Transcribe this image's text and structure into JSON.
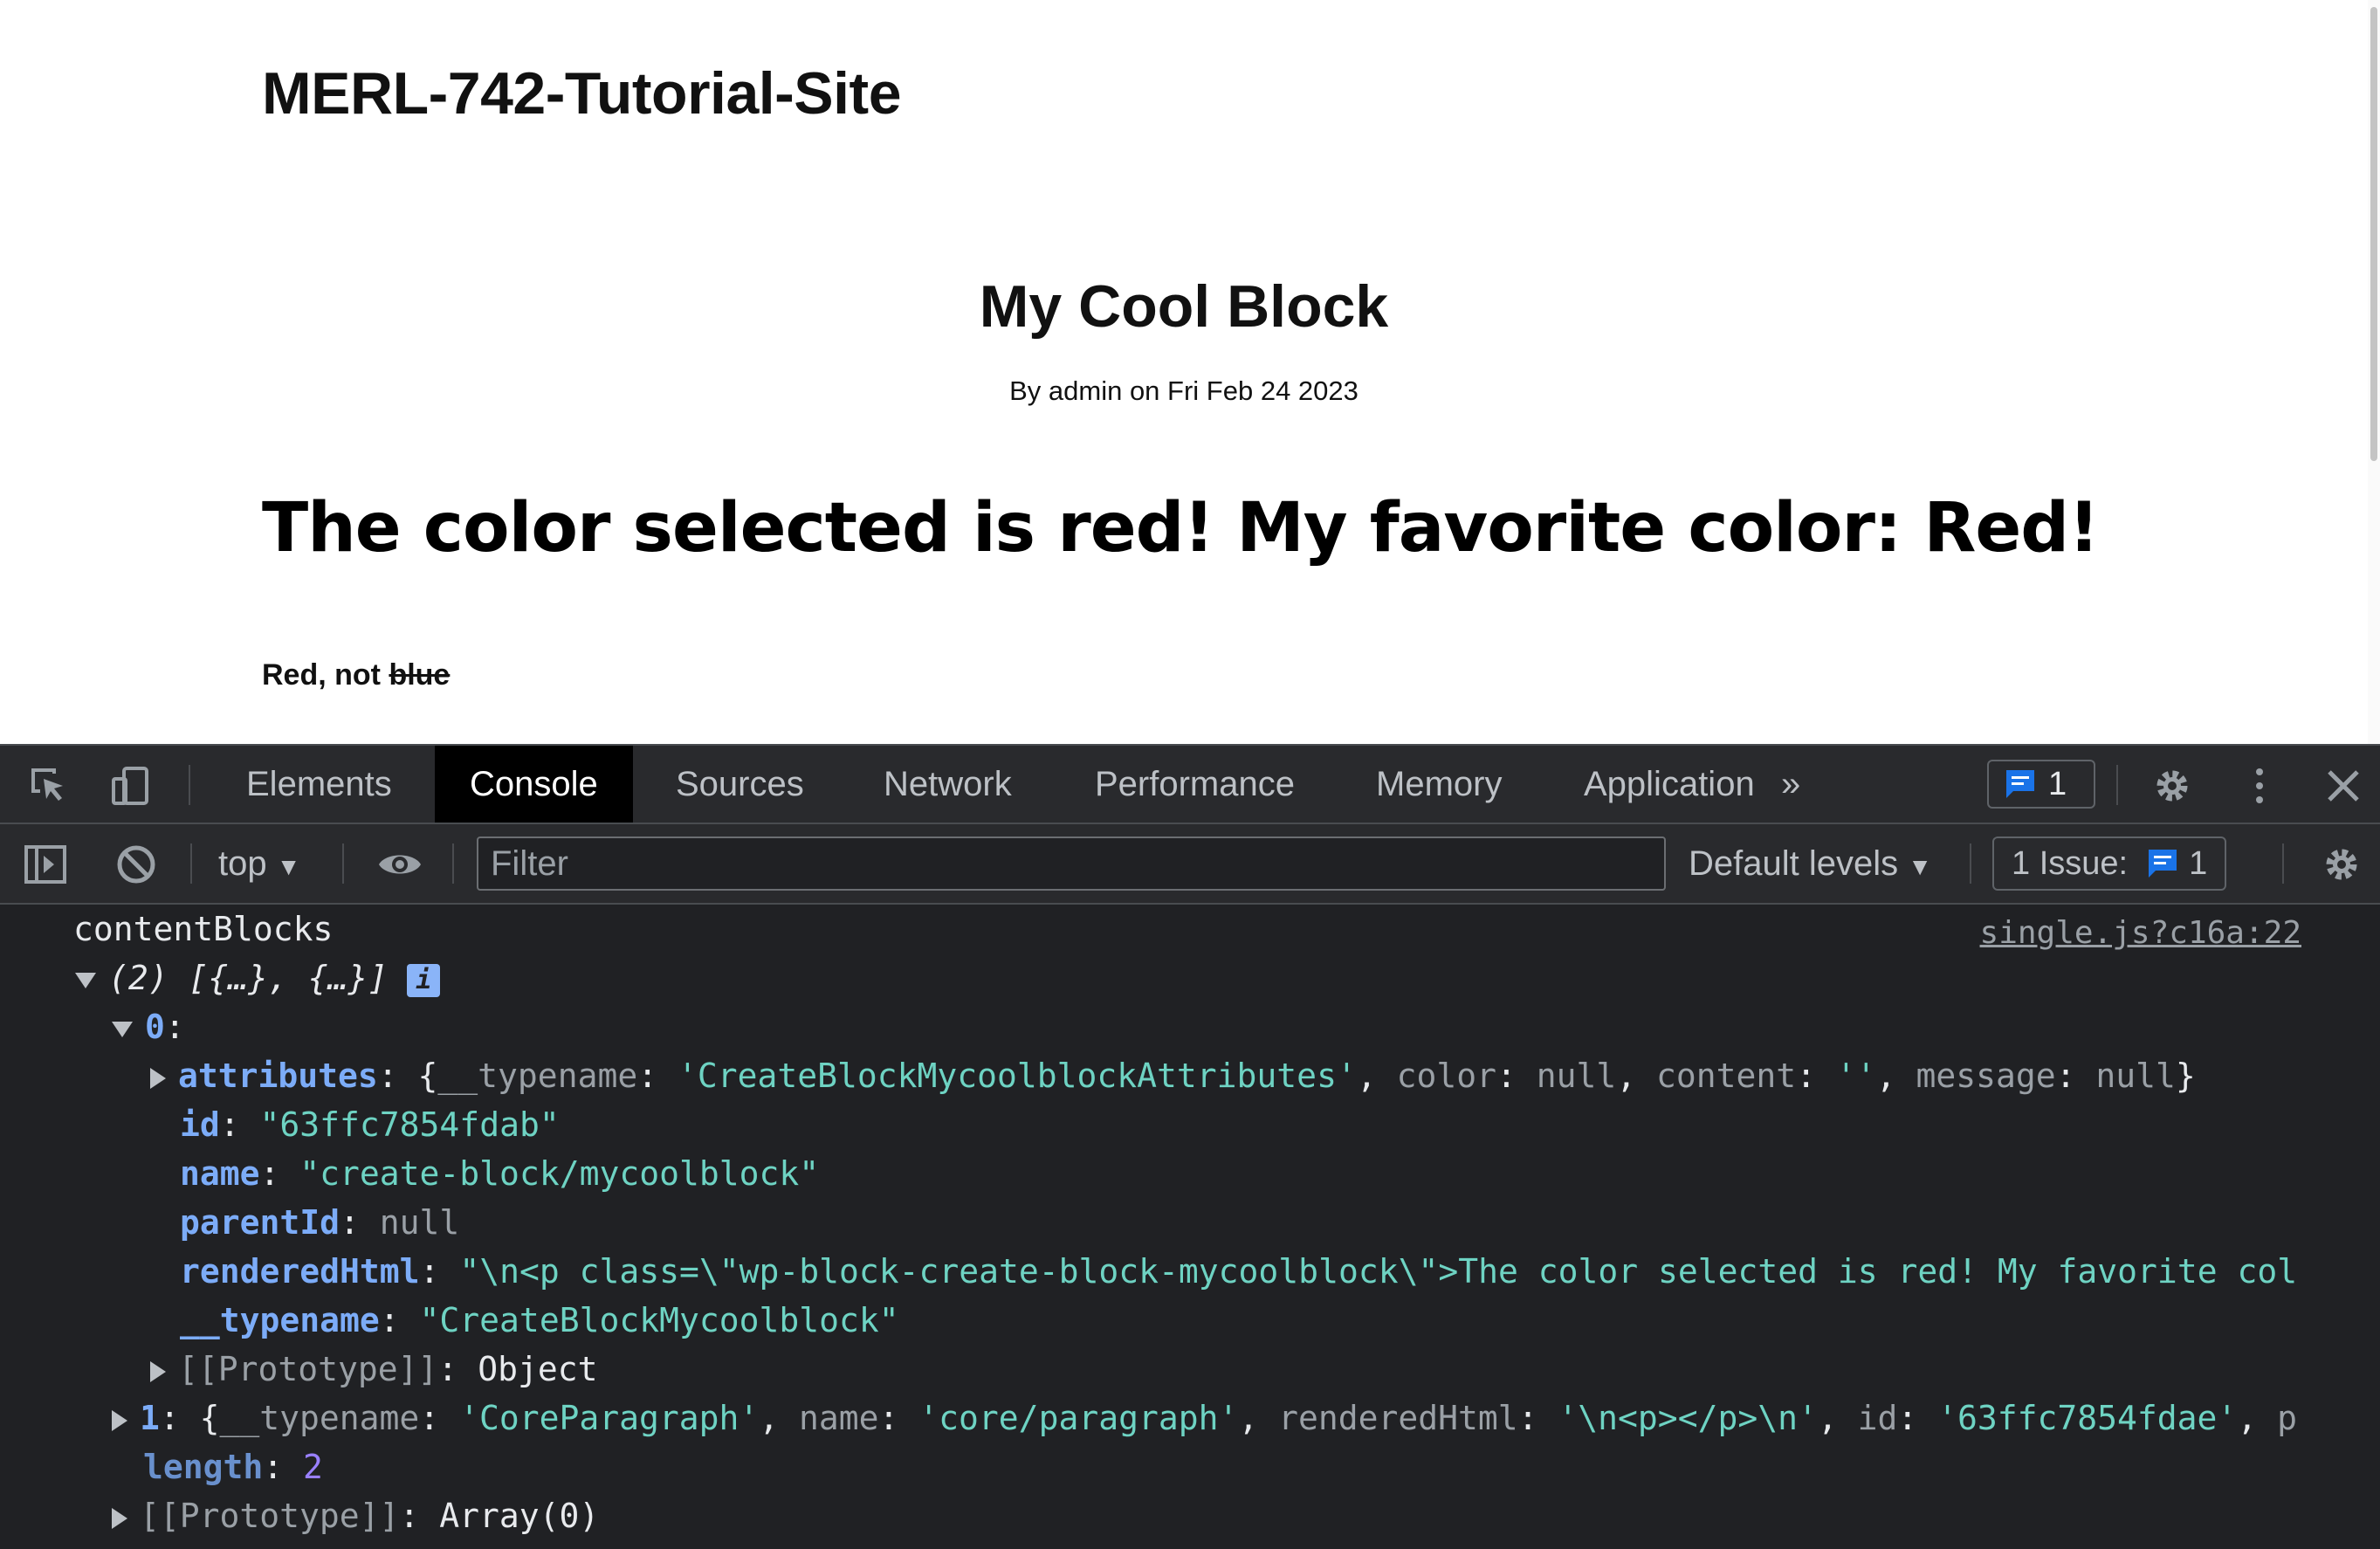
{
  "page": {
    "site_title": "MERL-742-Tutorial-Site",
    "post_title": "My Cool Block",
    "post_meta": "By admin on Fri Feb 24 2023",
    "block_heading": "The color selected is red! My favorite color: Red!",
    "paragraph_prefix": "Red, not ",
    "paragraph_struck": "blue"
  },
  "devtools": {
    "tabs": [
      {
        "label": "Elements",
        "active": false
      },
      {
        "label": "Console",
        "active": true
      },
      {
        "label": "Sources",
        "active": false
      },
      {
        "label": "Network",
        "active": false
      },
      {
        "label": "Performance",
        "active": false
      },
      {
        "label": "Memory",
        "active": false
      },
      {
        "label": "Application",
        "active": false
      }
    ],
    "more_tabs": "»",
    "message_count": "1",
    "toolbar": {
      "context": "top",
      "filter_placeholder": "Filter",
      "levels": "Default levels",
      "issues_label": "1 Issue:",
      "issues_count": "1"
    },
    "console": {
      "log_label": "contentBlocks",
      "source_link": "single.js?c16a:22",
      "array_summary": "(2) [{…}, {…}]",
      "info_badge": "i",
      "item0_index": "0",
      "attributes_key": "attributes",
      "attributes_preview_typename": "'CreateBlockMycoolblockAttributes'",
      "attributes_preview_color": "null",
      "attributes_preview_content": "''",
      "attributes_preview_message": "null",
      "id_key": "id",
      "id_value": "\"63ffc7854fdab\"",
      "name_key": "name",
      "name_value": "\"create-block/mycoolblock\"",
      "parentId_key": "parentId",
      "parentId_value": "null",
      "renderedHtml_key": "renderedHtml",
      "renderedHtml_value": "\"\\n<p class=\\\"wp-block-create-block-mycoolblock\\\">The color selected is red! My favorite col",
      "typename_key": "__typename",
      "typename_value": "\"CreateBlockMycoolblock\"",
      "proto_key": "[[Prototype]]",
      "proto_value": "Object",
      "item1_index": "1",
      "item1_typename": "'CoreParagraph'",
      "item1_name": "'core/paragraph'",
      "item1_renderedHtml": "'\\n<p></p>\\n'",
      "item1_id": "'63ffc7854fdae'",
      "item1_tail": "p",
      "length_key": "length",
      "length_value": "2",
      "array_proto_key": "[[Prototype]]",
      "array_proto_value": "Array(0)"
    }
  },
  "colors": {
    "devtools_bg": "#202124",
    "toolbar_bg": "#292a2d",
    "key_blue": "#7cacf8",
    "string_teal": "#6ed3c3",
    "number_purple": "#9980ff",
    "badge_blue": "#1a73e8"
  },
  "icons": [
    "inspect-icon",
    "device-toggle-icon",
    "sidebar-toggle-icon",
    "clear-console-icon",
    "eye-icon",
    "message-icon",
    "gear-icon",
    "kebab-menu-icon",
    "close-icon"
  ]
}
